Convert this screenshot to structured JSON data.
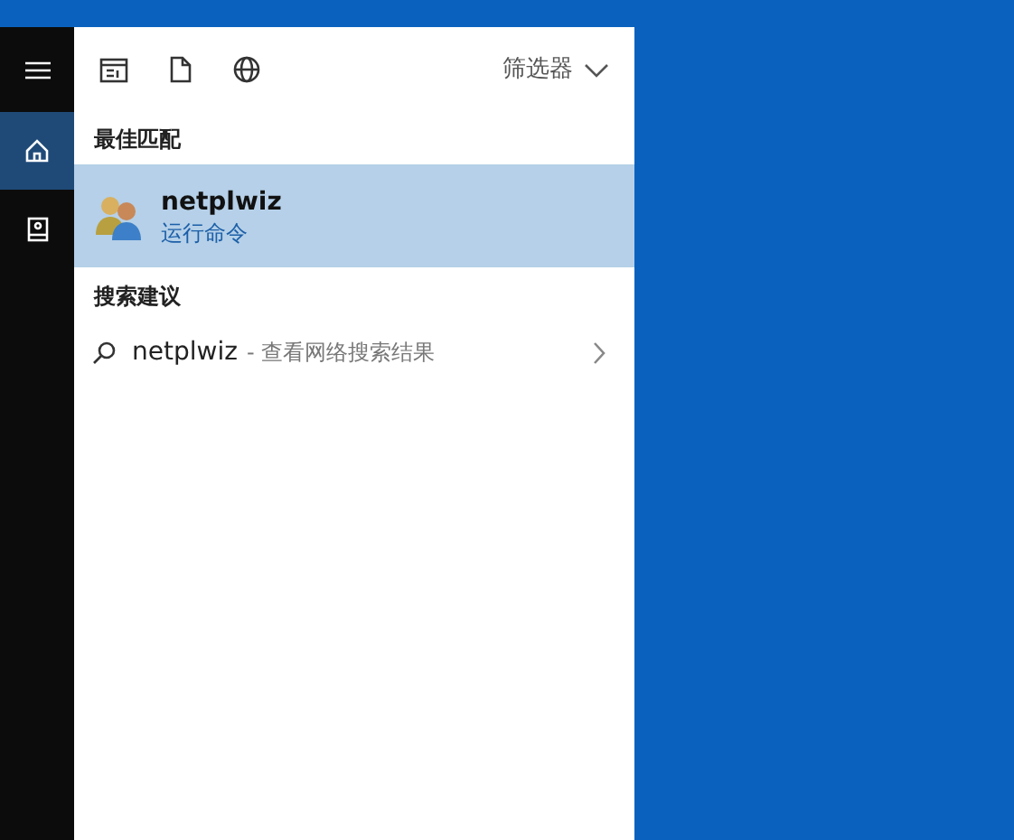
{
  "rail": {
    "items": [
      {
        "kind": "menu",
        "selected": false
      },
      {
        "kind": "home",
        "selected": true
      },
      {
        "kind": "notebook",
        "selected": false
      }
    ]
  },
  "toolbar": {
    "icons": [
      {
        "kind": "apps"
      },
      {
        "kind": "document"
      },
      {
        "kind": "web"
      }
    ],
    "filter": {
      "label": "筛选器"
    }
  },
  "best_match": {
    "heading": "最佳匹配",
    "items": [
      {
        "title": "netplwiz",
        "subtitle": "运行命令",
        "selected": true
      }
    ]
  },
  "suggestions": {
    "heading": "搜索建议",
    "items": [
      {
        "query": "netplwiz",
        "description": "- 查看网络搜索结果",
        "selected": false
      }
    ]
  }
}
